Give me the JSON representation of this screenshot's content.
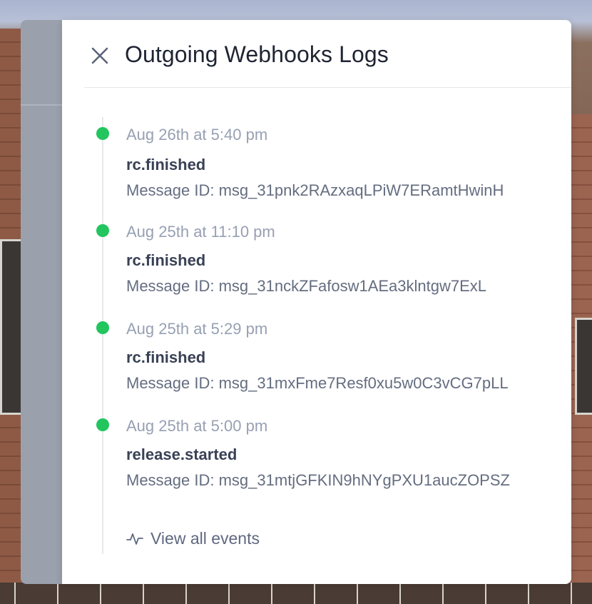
{
  "drawer": {
    "title": "Outgoing Webhooks Logs",
    "close_icon": "close-icon"
  },
  "events": [
    {
      "time": "Aug 26th at 5:40 pm",
      "name": "rc.finished",
      "message_id": "Message ID: msg_31pnk2RAzxaqLPiW7ERamtHwinH",
      "status_color": "#22c55e"
    },
    {
      "time": "Aug 25th at 11:10 pm",
      "name": "rc.finished",
      "message_id": "Message ID: msg_31nckZFafosw1AEa3klntgw7ExL",
      "status_color": "#22c55e"
    },
    {
      "time": "Aug 25th at 5:29 pm",
      "name": "rc.finished",
      "message_id": "Message ID: msg_31mxFme7Resf0xu5w0C3vCG7pLL",
      "status_color": "#22c55e"
    },
    {
      "time": "Aug 25th at 5:00 pm",
      "name": "release.started",
      "message_id": "Message ID: msg_31mtjGFKIN9hNYgPXU1aucZOPSZ",
      "status_color": "#22c55e"
    }
  ],
  "footer": {
    "view_all_label": "View all events",
    "view_all_icon": "activity-icon"
  }
}
